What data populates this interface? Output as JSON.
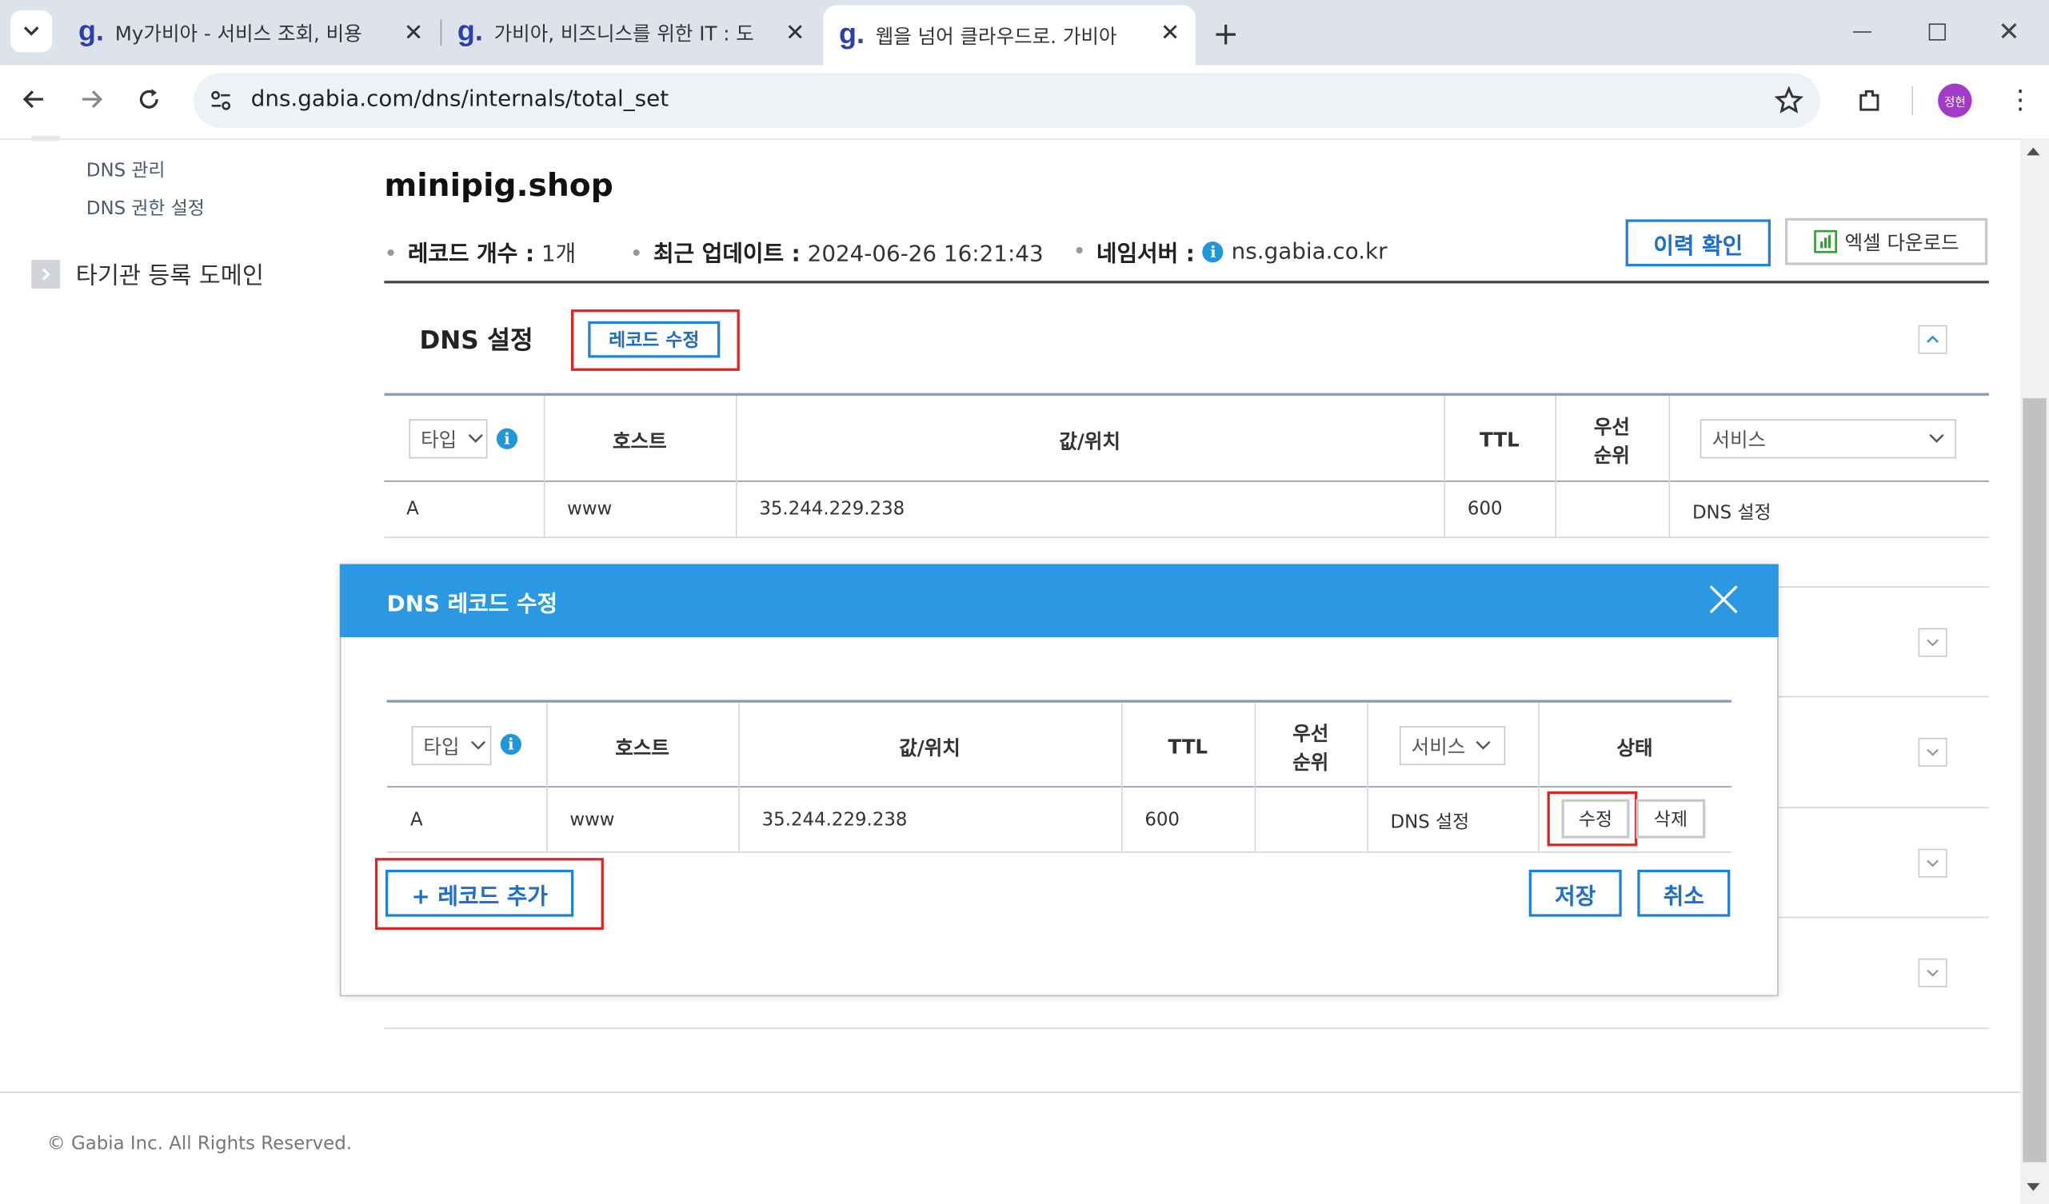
{
  "browser": {
    "tabs": [
      {
        "title": "My가비아 - 서비스 조회, 비용",
        "active": false
      },
      {
        "title": "가비아, 비즈니스를 위한 IT : 도",
        "active": false
      },
      {
        "title": "웹을 넘어 클라우드로. 가비아",
        "active": true
      }
    ],
    "url": "dns.gabia.com/dns/internals/total_set",
    "profile_initials": "정현"
  },
  "sidebar": {
    "links": [
      "DNS 관리",
      "DNS 권한 설정"
    ],
    "section": "타기관 등록 도메인"
  },
  "header": {
    "domain": "minipig.shop",
    "record_count_label": "레코드 개수 :",
    "record_count_value": "1개",
    "updated_label": "최근 업데이트 :",
    "updated_value": "2024-06-26 16:21:43",
    "nameserver_label": "네임서버 :",
    "nameserver_value": "ns.gabia.co.kr",
    "history_button": "이력 확인",
    "excel_button": "엑셀 다운로드"
  },
  "dns_section": {
    "title": "DNS 설정",
    "edit_button": "레코드 수정",
    "columns": {
      "type": "타입",
      "host": "호스트",
      "value": "값/위치",
      "ttl": "TTL",
      "priority_line1": "우선",
      "priority_line2": "순위",
      "service": "서비스"
    },
    "rows": [
      {
        "type": "A",
        "host": "www",
        "value": "35.244.229.238",
        "ttl": "600",
        "priority": "",
        "service": "DNS 설정"
      }
    ]
  },
  "modal": {
    "title": "DNS 레코드 수정",
    "columns": {
      "type": "타입",
      "host": "호스트",
      "value": "값/위치",
      "ttl": "TTL",
      "priority_line1": "우선",
      "priority_line2": "순위",
      "service": "서비스",
      "status": "상태"
    },
    "rows": [
      {
        "type": "A",
        "host": "www",
        "value": "35.244.229.238",
        "ttl": "600",
        "priority": "",
        "service": "DNS 설정",
        "edit": "수정",
        "delete": "삭제"
      }
    ],
    "add_button": "+ 레코드 추가",
    "save_button": "저장",
    "cancel_button": "취소"
  },
  "footer": {
    "copyright": "© Gabia Inc. All Rights Reserved."
  },
  "colors": {
    "accent": "#2b98e3",
    "highlight": "#e02323"
  }
}
